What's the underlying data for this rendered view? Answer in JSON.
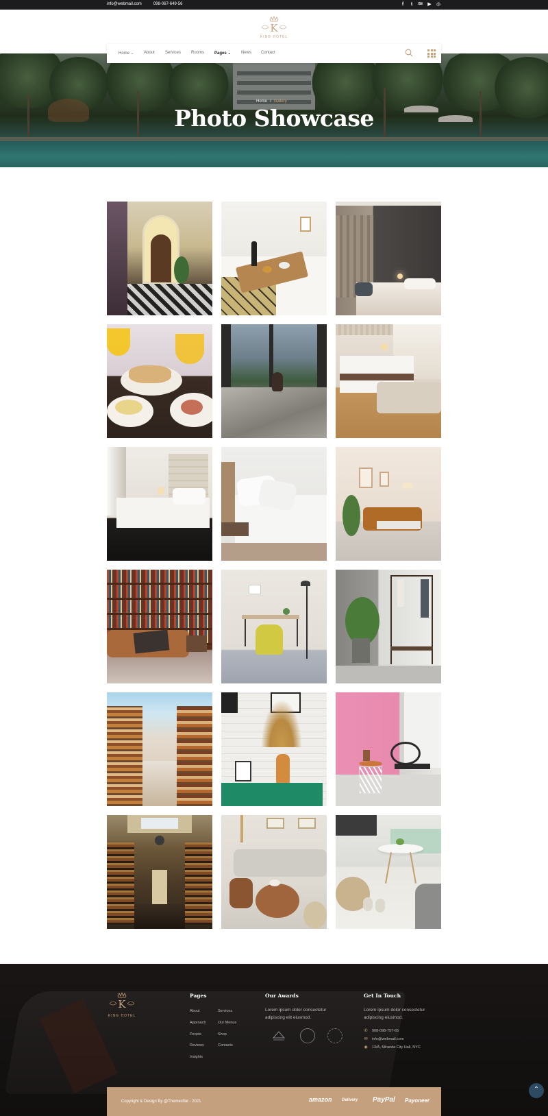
{
  "topbar": {
    "email": "info@webmail.com",
    "phone": "098-067-649-56",
    "socials": [
      "facebook-icon",
      "twitter-icon",
      "behance-icon",
      "youtube-icon",
      "instagram-icon"
    ]
  },
  "brand": {
    "name": "KING HOTEL",
    "initial": "K"
  },
  "nav": {
    "items": [
      "Home",
      "About",
      "Services",
      "Rooms",
      "Pages",
      "News",
      "Contact"
    ],
    "active": "Pages"
  },
  "hero": {
    "title": "Photo Showcase",
    "breadcrumb": [
      "Home",
      "Gallery"
    ]
  },
  "gallery": {
    "photos": [
      "hotel-lobby-photo",
      "breakfast-tray-bed-photo",
      "modern-bedroom-photo",
      "brunch-table-photo",
      "woman-bed-window-photo",
      "bedroom-bench-photo",
      "bed-padded-headboard-photo",
      "white-pillows-bed-photo",
      "living-room-sofa-photo",
      "library-leather-sofa-photo",
      "desk-yellow-chair-photo",
      "plant-clothes-rack-photo",
      "library-aisle-photo",
      "dried-flowers-vase-photo",
      "pink-wall-chairs-photo",
      "grand-library-photo",
      "lounge-wood-tables-photo",
      "round-table-slippers-photo"
    ]
  },
  "footer": {
    "pages_heading": "Pages",
    "pages_col1": [
      "About",
      "Approach",
      "People",
      "Reviews",
      "Insights"
    ],
    "pages_col2": [
      "Services",
      "Our Menus",
      "Shop",
      "Contacts"
    ],
    "awards_heading": "Our Awards",
    "awards_text": "Lorem ipsum dolor  consectetur adipiscing elit eiusmod.",
    "contact_heading": "Get In Touch",
    "contact_text": "Lorem ipsum dolor  consectetur adipiscing eiusmod.",
    "phone": "908-098-757-65",
    "email": "info@webmail.com",
    "address": "13/A, Miranda City Hall, NYC",
    "copyright": "Copyright & Design By @Themesflat - 2021",
    "partners": [
      "amazon",
      "Delivery",
      "PayPal",
      "Payoneer"
    ]
  },
  "colors": {
    "accent": "#c8a27a",
    "bottombar": "#c5a07f",
    "topbar": "#1c1c1e"
  }
}
